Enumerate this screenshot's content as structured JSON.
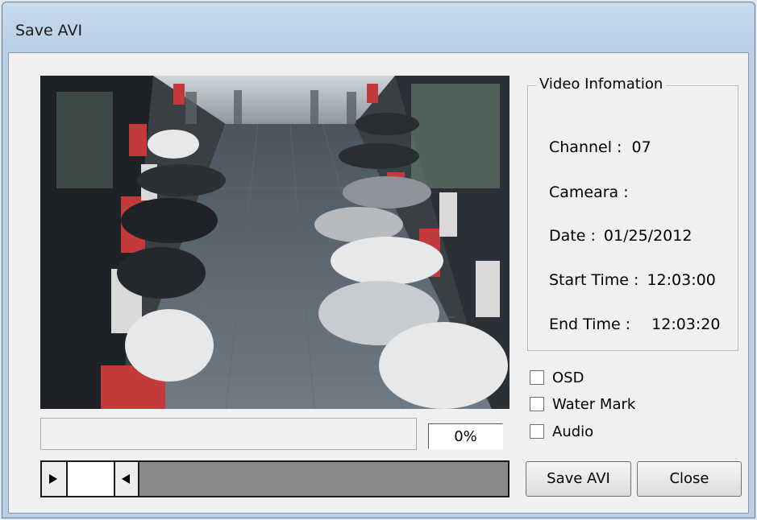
{
  "window": {
    "title": "Save AVI"
  },
  "video_info": {
    "group_title": "Video Infomation",
    "channel_label": "Channel :",
    "channel_value": "07",
    "camera_label": "Cameara :",
    "camera_value": "",
    "date_label": "Date :",
    "date_value": "01/25/2012",
    "start_label": "Start Time :",
    "start_value": "12:03:00",
    "end_label": "End Time :",
    "end_value": "12:03:20"
  },
  "options": [
    {
      "label": "OSD",
      "checked": false
    },
    {
      "label": "Water Mark",
      "checked": false
    },
    {
      "label": "Audio",
      "checked": false
    }
  ],
  "progress": {
    "percent_text": "0%",
    "fraction": 0
  },
  "buttons": {
    "save": "Save AVI",
    "close": "Close"
  }
}
